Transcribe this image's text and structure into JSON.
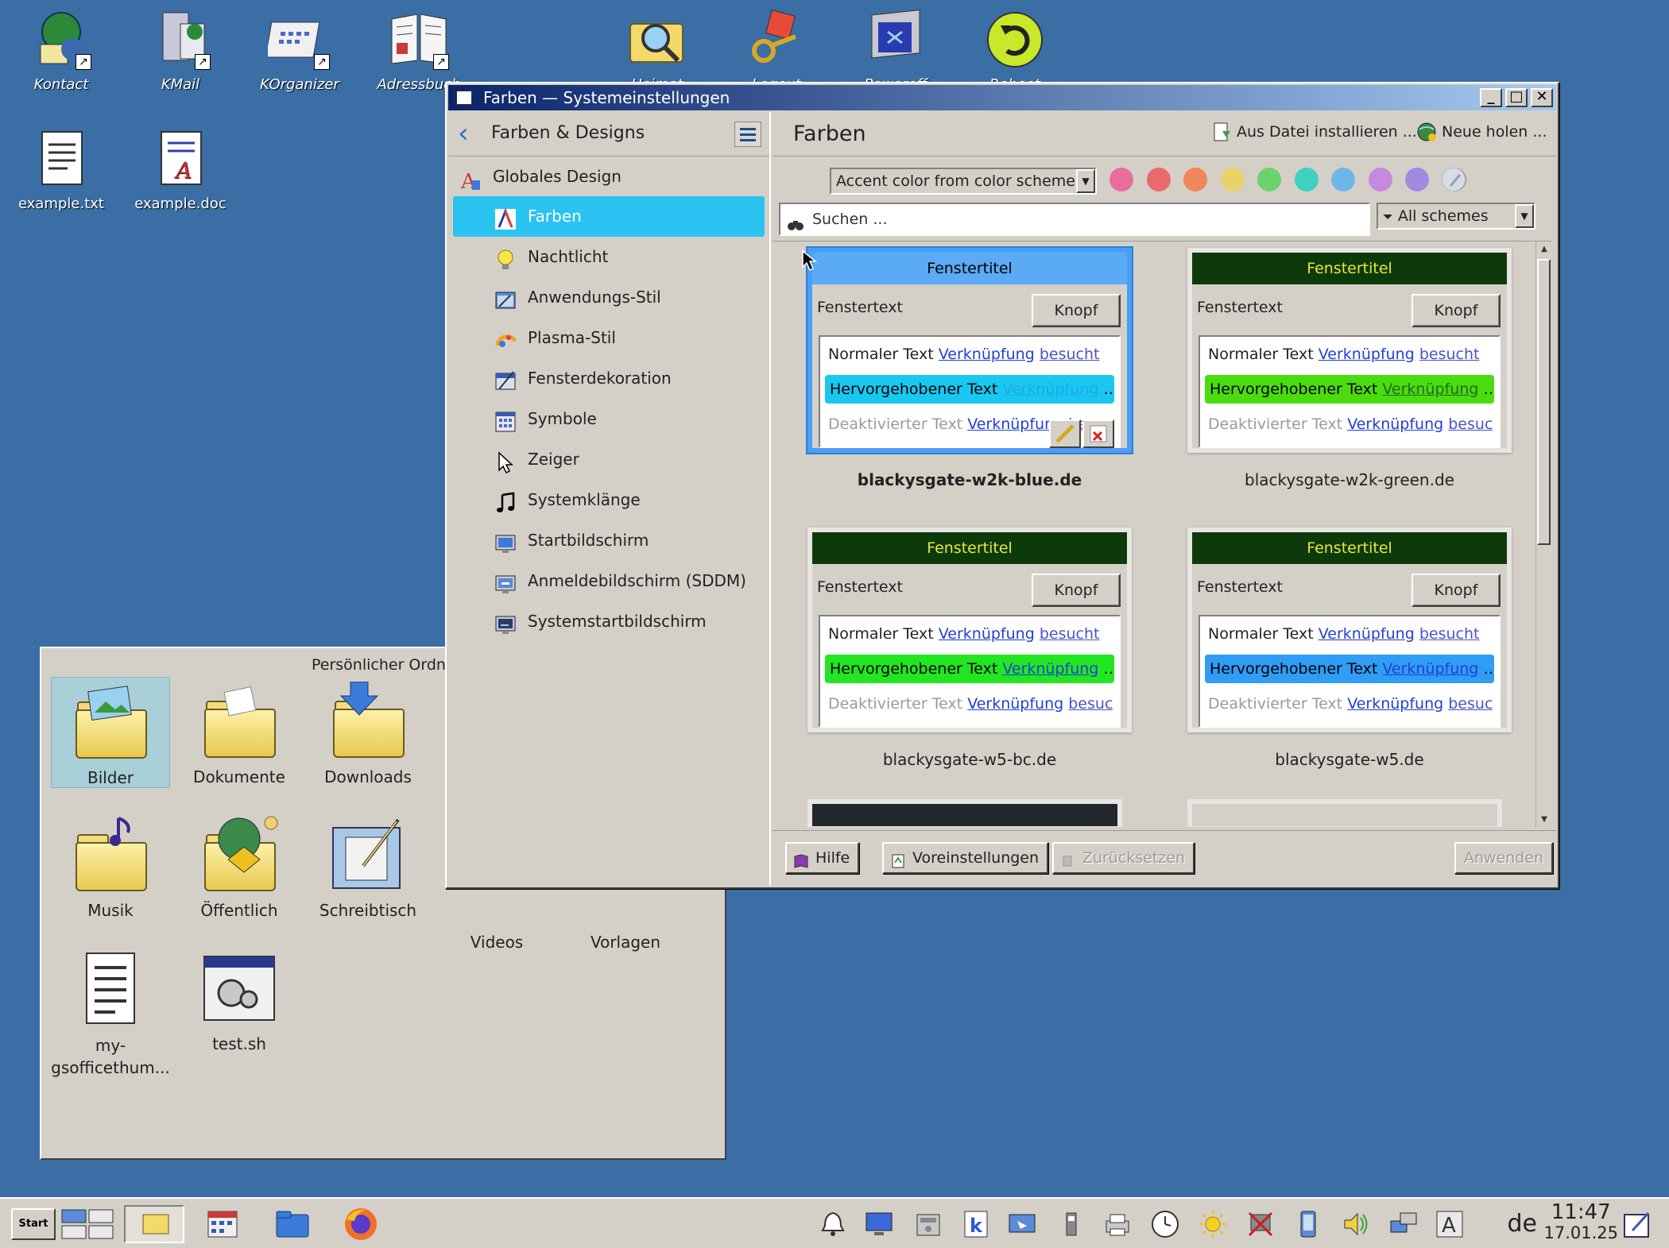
{
  "desktop": {
    "icons": [
      {
        "label": "Kontact"
      },
      {
        "label": "KMail"
      },
      {
        "label": "KOrganizer"
      },
      {
        "label": "Adressbuch"
      },
      {
        "label": "Heimat"
      },
      {
        "label": "Logout"
      },
      {
        "label": "Poweroff"
      },
      {
        "label": "Reboot"
      },
      {
        "label": "example.txt"
      },
      {
        "label": "example.doc"
      }
    ]
  },
  "filemanager": {
    "title": "Persönlicher Ordn",
    "items": [
      {
        "label": "Bilder"
      },
      {
        "label": "Dokumente"
      },
      {
        "label": "Downloads"
      },
      {
        "label": "Musik"
      },
      {
        "label": "Öffentlich"
      },
      {
        "label": "Schreibtisch"
      },
      {
        "label": "Videos"
      },
      {
        "label": "Vorlagen"
      },
      {
        "label": "my-gsofficethum..."
      },
      {
        "label": "test.sh"
      }
    ]
  },
  "window": {
    "title": "Farben — Systemeinstellungen",
    "nav": {
      "header": "Farben & Designs",
      "top_item": "Globales Design",
      "items": [
        {
          "label": "Farben",
          "active": true
        },
        {
          "label": "Nachtlicht"
        },
        {
          "label": "Anwendungs-Stil"
        },
        {
          "label": "Plasma-Stil"
        },
        {
          "label": "Fensterdekoration"
        },
        {
          "label": "Symbole"
        },
        {
          "label": "Zeiger"
        },
        {
          "label": "Systemklänge"
        },
        {
          "label": "Startbildschirm"
        },
        {
          "label": "Anmeldebildschirm (SDDM)"
        },
        {
          "label": "Systemstartbildschirm"
        }
      ]
    },
    "content": {
      "title": "Farben",
      "install_from_file": "Aus Datei installieren ...",
      "get_new": "Neue holen ...",
      "accent_combo": "Accent color from color scheme",
      "accent_colors": [
        "#e86d9d",
        "#e86a6a",
        "#f0875a",
        "#e9d26a",
        "#6bd36b",
        "#3ed0c0",
        "#6fb6e8",
        "#c58ae0",
        "#a28ae0",
        "#8c8c8c"
      ],
      "search_placeholder": "Suchen ...",
      "filter_combo": "All schemes",
      "schemes": [
        {
          "name": "blackysgate-w2k-blue.de",
          "selected": true,
          "title_bg": "#5aaaf5",
          "title_fg": "#000000",
          "highlight_bg": "#18c8f0",
          "highlight_link": "#1fa8e8"
        },
        {
          "name": "blackysgate-w2k-green.de",
          "title_bg": "#0d3a0a",
          "title_fg": "#e8e83a",
          "highlight_bg": "#4bdc10",
          "highlight_link": "#1f6a1f"
        },
        {
          "name": "blackysgate-w5-bc.de",
          "title_bg": "#0d3a0a",
          "title_fg": "#e8e83a",
          "highlight_bg": "#22e622",
          "highlight_link": "#1f3fd6"
        },
        {
          "name": "blackysgate-w5.de",
          "title_bg": "#0d3a0a",
          "title_fg": "#e8e83a",
          "highlight_bg": "#2f9cf5",
          "highlight_link": "#1f3fd6"
        }
      ],
      "preview": {
        "window_title": "Fenstertitel",
        "window_text": "Fenstertext",
        "button": "Knopf",
        "normal_text": "Normaler Text",
        "link": "Verknüpfung",
        "visited": "besucht",
        "highlighted_text": "Hervorgehobener Text",
        "disabled_text": "Deaktivierter Text"
      }
    },
    "buttons": {
      "help": "Hilfe",
      "defaults": "Voreinstellungen",
      "reset": "Zurücksetzen",
      "apply": "Anwenden"
    }
  },
  "taskbar": {
    "start": "Start",
    "language": "de",
    "time": "11:47",
    "date": "17.01.25"
  }
}
